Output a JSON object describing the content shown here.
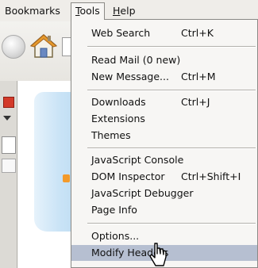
{
  "menubar": {
    "bookmarks": "Bookmarks",
    "tools_key": "T",
    "tools_rest": "ools",
    "help_key": "H",
    "help_rest": "elp"
  },
  "menu": {
    "web_search": {
      "label": "Web Search",
      "shortcut": "Ctrl+K"
    },
    "read_mail": {
      "label": "Read Mail (0 new)"
    },
    "new_message": {
      "label": "New Message...",
      "shortcut": "Ctrl+M"
    },
    "downloads": {
      "label": "Downloads",
      "shortcut": "Ctrl+J"
    },
    "extensions": {
      "label": "Extensions"
    },
    "themes": {
      "label": "Themes"
    },
    "javascript_console": {
      "label": "JavaScript Console"
    },
    "dom_inspector": {
      "label": "DOM Inspector",
      "shortcut": "Ctrl+Shift+I"
    },
    "javascript_debugger": {
      "label": "JavaScript Debugger"
    },
    "page_info": {
      "label": "Page Info"
    },
    "options": {
      "label": "Options..."
    },
    "modify_headers": {
      "label": "Modify Headers"
    }
  },
  "colors": {
    "menu_background": "#f7f6f4",
    "highlight": "#b6bfd1",
    "separator": "#b3b1ac"
  },
  "icons": [
    "navigation-button-icon",
    "home-icon",
    "dropdown-arrow-icon",
    "mouse-pointer-icon"
  ]
}
